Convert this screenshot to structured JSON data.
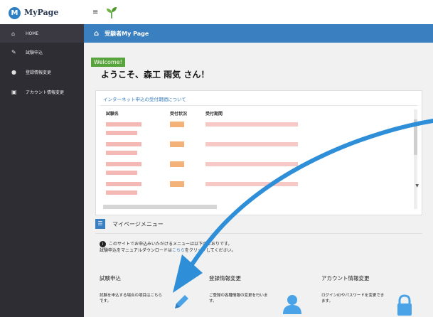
{
  "app": {
    "logo_letter": "M",
    "title": "MyPage",
    "menu_glyph": "≡"
  },
  "sidebar": {
    "items": [
      {
        "label": "HOME",
        "icon": "home-icon"
      },
      {
        "label": "試験申込",
        "icon": "pencil-icon"
      },
      {
        "label": "登録情報変更",
        "icon": "user-icon"
      },
      {
        "label": "アカウント情報変更",
        "icon": "lock-icon"
      }
    ]
  },
  "header": {
    "title": "受験者My Page"
  },
  "welcome": {
    "badge": "Welcome!",
    "greeting": "ようこそ、森工 雨気 さん！"
  },
  "news_panel": {
    "title": "インターネット申込の受付期間について",
    "columns": [
      "試験名",
      "受付状況",
      "受付期間"
    ]
  },
  "menu": {
    "title": "マイページメニュー",
    "notice_line1": "このサイトでお申込みいただけるメニューは以下のとおりです。",
    "notice_line2_pre": "試験申込をマニュアルダウンロードは",
    "notice_link": "こちら",
    "notice_line2_post": "をクリックしてください。"
  },
  "cards": [
    {
      "title": "試験申込",
      "desc": "試験を申込する場合の項目はこちらです。"
    },
    {
      "title": "登録情報変更",
      "desc": "ご登録の各種情報の変更を行います。"
    },
    {
      "title": "アカウント情報変更",
      "desc": "ログインIDやパスワードを変更できます。"
    }
  ],
  "colors": {
    "sidebar": "#2e2d34",
    "header": "#3a7fc0",
    "welcome_badge": "#58a43c",
    "annotation_arrow": "#2e8fd8"
  }
}
